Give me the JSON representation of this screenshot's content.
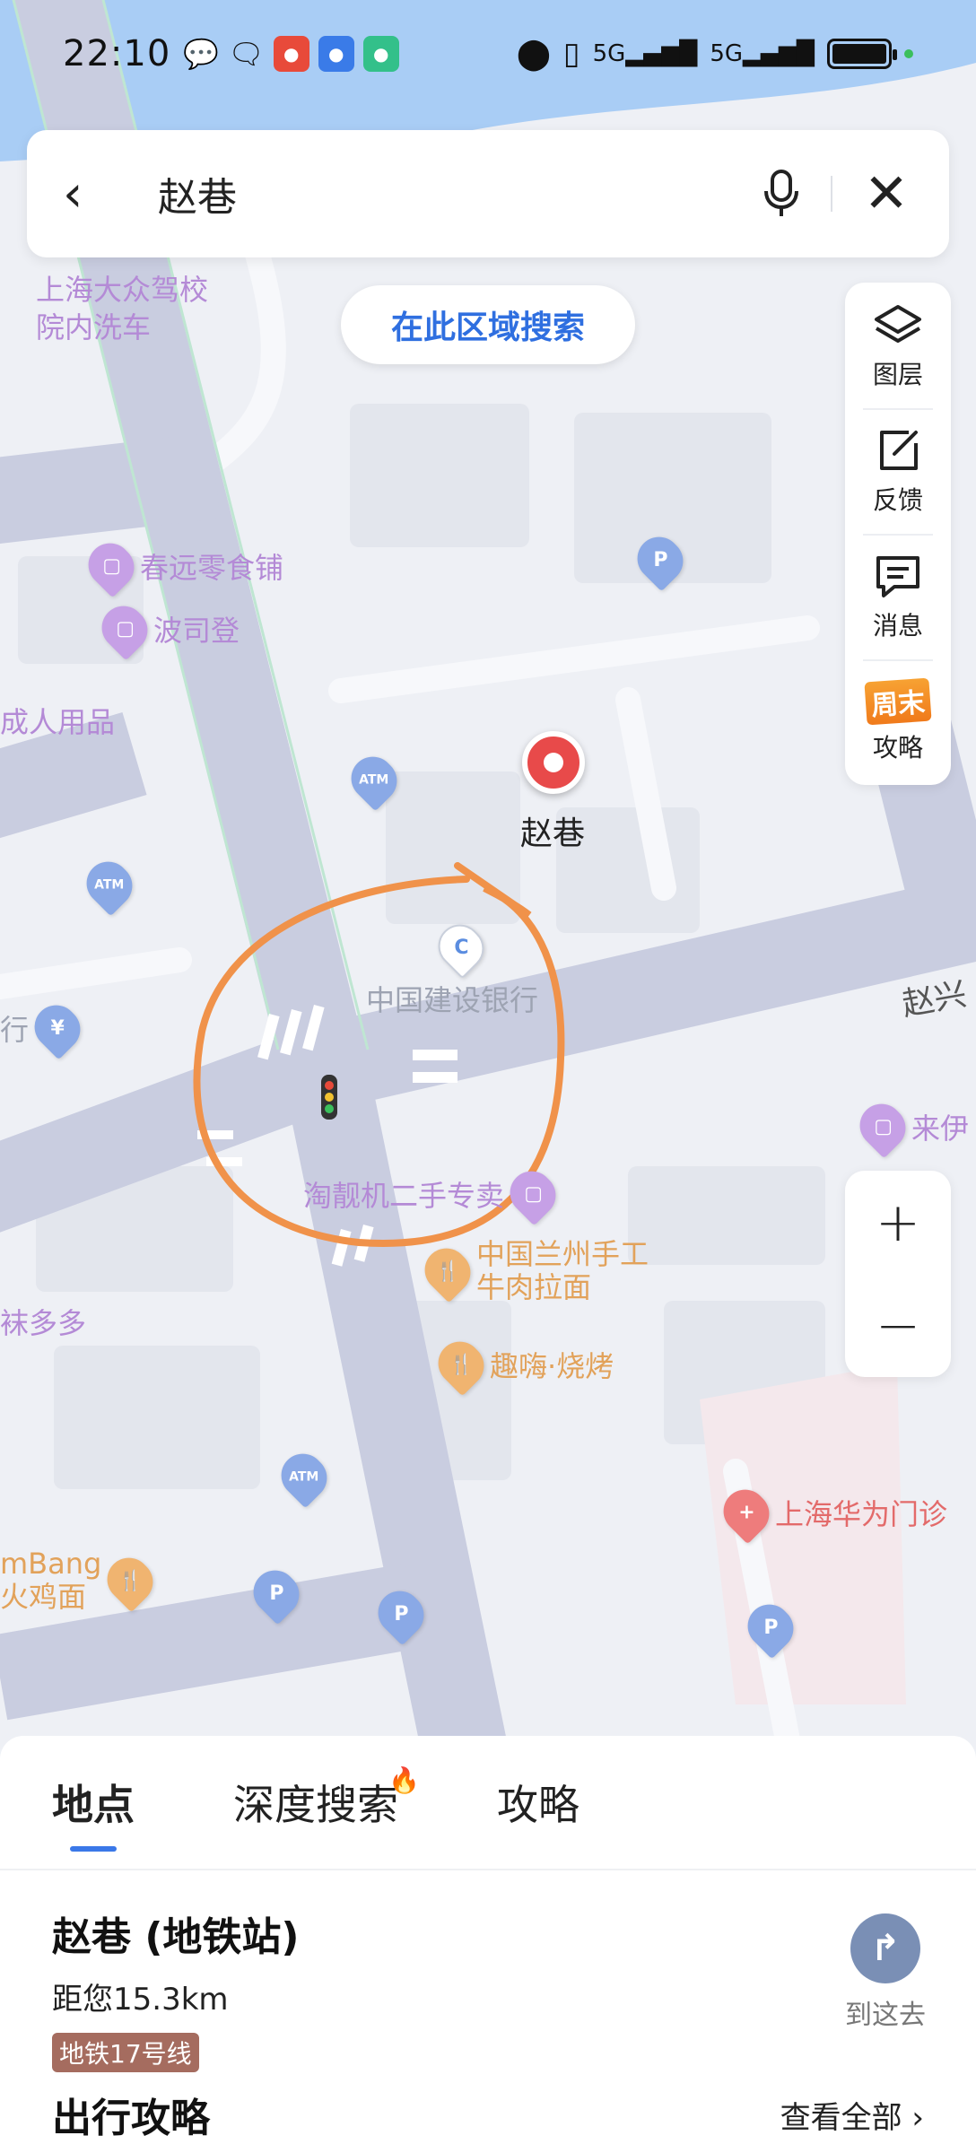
{
  "status_bar": {
    "time": "22:10",
    "network_1": "5G",
    "network_2": "5G"
  },
  "search": {
    "query": "赵巷",
    "back_icon": "back-arrow-icon",
    "mic_icon": "microphone-icon",
    "close_icon": "close-icon"
  },
  "area_search_label": "在此区域搜索",
  "tools": {
    "layers": "图层",
    "feedback": "反馈",
    "messages": "消息",
    "weekend_badge": "周末",
    "guide": "攻略"
  },
  "zoom": {
    "in": "+",
    "out": "−"
  },
  "map": {
    "pois": [
      "上海大众驾校",
      "院内洗车",
      "春远零食铺",
      "波司登",
      "成人用品",
      "赵巷",
      "中国建设银行",
      "赵兴",
      "来伊",
      "淘靓机二手专卖",
      "中国兰州手工",
      "牛肉拉面",
      "趣嗨·烧烤",
      "袜多多",
      "上海华为门诊",
      "mBang",
      "火鸡面",
      "行"
    ]
  },
  "sheet": {
    "tabs": [
      "地点",
      "深度搜索",
      "攻略"
    ],
    "result": {
      "name": "赵巷 (地铁站)",
      "distance": "距您15.3km",
      "line": "地铁17号线",
      "goto": "到这去"
    },
    "guide": {
      "title": "出行攻略",
      "more": "查看全部 ›"
    }
  },
  "colors": {
    "accent": "#3a78e8",
    "annotation_circle": "#f0924a",
    "poi_purple": "#c6a0e6"
  }
}
